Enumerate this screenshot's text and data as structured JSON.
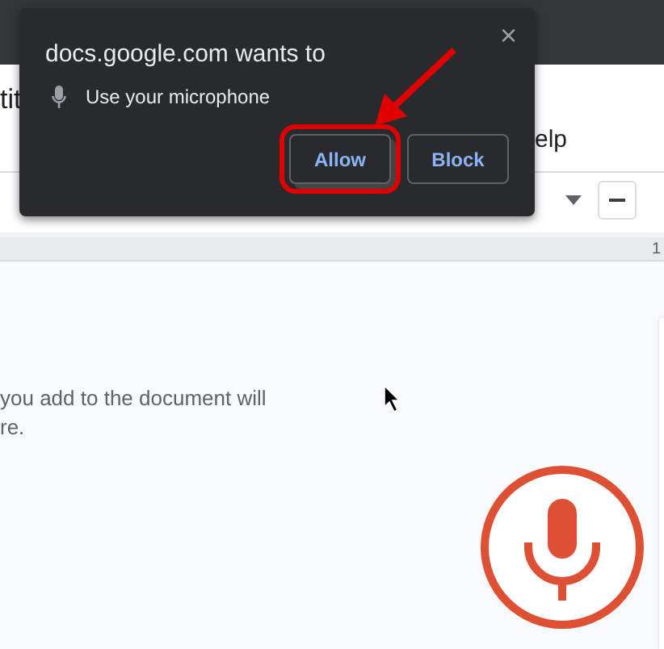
{
  "document": {
    "title": "tit",
    "menu_item": "elp",
    "ruler_mark": "1",
    "message_lines": [
      "you add to the document will",
      "re."
    ]
  },
  "permission_prompt": {
    "title": "docs.google.com wants to",
    "permission": "Use your microphone",
    "close_label": "×",
    "buttons": [
      {
        "label": "Allow",
        "highlighted": true
      },
      {
        "label": "Block",
        "highlighted": false
      }
    ]
  }
}
